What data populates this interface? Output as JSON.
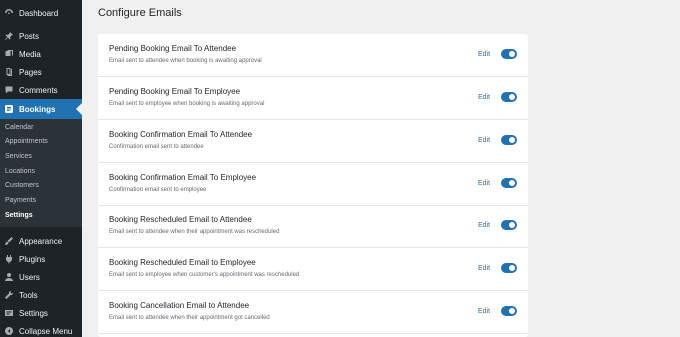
{
  "sidebar": {
    "items": [
      {
        "label": "Dashboard",
        "icon": "dashboard-icon"
      },
      {
        "label": "Posts",
        "icon": "pin-icon"
      },
      {
        "label": "Media",
        "icon": "media-icon"
      },
      {
        "label": "Pages",
        "icon": "pages-icon"
      },
      {
        "label": "Comments",
        "icon": "comment-icon"
      },
      {
        "label": "Bookings",
        "icon": "bookings-icon"
      },
      {
        "label": "Appearance",
        "icon": "brush-icon"
      },
      {
        "label": "Plugins",
        "icon": "plugin-icon"
      },
      {
        "label": "Users",
        "icon": "user-icon"
      },
      {
        "label": "Tools",
        "icon": "wrench-icon"
      },
      {
        "label": "Settings",
        "icon": "settings-icon"
      },
      {
        "label": "Collapse Menu",
        "icon": "collapse-icon"
      }
    ],
    "submenu": [
      "Calendar",
      "Appointments",
      "Services",
      "Locations",
      "Customers",
      "Payments",
      "Settings"
    ]
  },
  "page": {
    "title": "Configure Emails"
  },
  "emails": [
    {
      "title": "Pending Booking Email To Attendee",
      "desc": "Email sent to attendee when booking is awaiting approval",
      "edit": "Edit",
      "enabled": true
    },
    {
      "title": "Pending Booking Email To Employee",
      "desc": "Email sent to employee when booking is awaiting approval",
      "edit": "Edit",
      "enabled": true
    },
    {
      "title": "Booking Confirmation Email To Attendee",
      "desc": "Confirmation email sent to attendee",
      "edit": "Edit",
      "enabled": true
    },
    {
      "title": "Booking Confirmation Email To Employee",
      "desc": "Confirmation email sent to employee",
      "edit": "Edit",
      "enabled": true
    },
    {
      "title": "Booking Rescheduled Email to Attendee",
      "desc": "Email sent to attendee when their appointment was rescheduled",
      "edit": "Edit",
      "enabled": true
    },
    {
      "title": "Booking Rescheduled Email to Employee",
      "desc": "Email sent to employee when customer's appointment was rescheduled",
      "edit": "Edit",
      "enabled": true
    },
    {
      "title": "Booking Cancellation Email to Attendee",
      "desc": "Email sent to attendee when their appointment got cancelled",
      "edit": "Edit",
      "enabled": true
    }
  ],
  "colors": {
    "accent": "#2271b1",
    "sidebar_bg": "#1d2327",
    "submenu_bg": "#2c3338"
  }
}
